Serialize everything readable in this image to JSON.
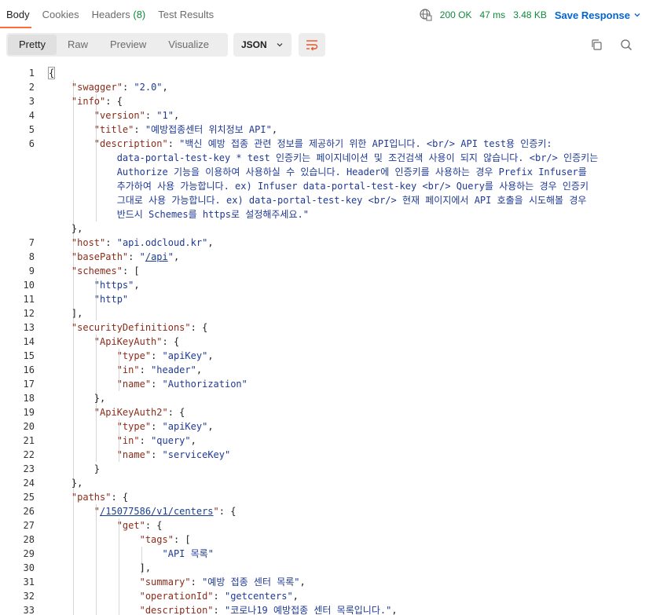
{
  "tabs": {
    "body": "Body",
    "cookies": "Cookies",
    "headers": "Headers",
    "headers_count": "(8)",
    "test_results": "Test Results"
  },
  "status": {
    "code": "200 OK",
    "time": "47 ms",
    "size": "3.48 KB",
    "save": "Save Response"
  },
  "view": {
    "pretty": "Pretty",
    "raw": "Raw",
    "preview": "Preview",
    "visualize": "Visualize",
    "format": "JSON"
  },
  "line_numbers": [
    "1",
    "2",
    "3",
    "4",
    "5",
    "6",
    "",
    "",
    "",
    "",
    "",
    "",
    "7",
    "8",
    "9",
    "10",
    "11",
    "12",
    "13",
    "14",
    "15",
    "16",
    "17",
    "18",
    "19",
    "20",
    "21",
    "22",
    "23",
    "24",
    "25",
    "26",
    "27",
    "28",
    "29",
    "30",
    "31",
    "32",
    "33",
    "34"
  ],
  "code": {
    "l1": "{",
    "l2k": "\"swagger\"",
    "l2v": "\"2.0\"",
    "l3k": "\"info\"",
    "l4k": "\"version\"",
    "l4v": "\"1\"",
    "l5k": "\"title\"",
    "l5v": "\"예방접종센터 위치정보 API\"",
    "l6k": "\"description\"",
    "l6v1": "\"백신 예방 접종 관련 정보를 제공하기 위한 API입니다. <br/> API test용 인증키:",
    "l6v2": "data-portal-test-key * test 인증키는 페이지네이션 및 조건검색 사용이 되지 않습니다. <br/> 인증키는",
    "l6v3": "Authorize 기능을 이용하여 사용하실 수 있습니다. Header에 인증키를 사용하는 경우 Prefix Infuser를",
    "l6v4": "추가하여 사용 가능합니다. ex) Infuser data-portal-test-key <br/> Query를 사용하는 경우 인증키",
    "l6v5": "그대로 사용 가능합니다. ex) data-portal-test-key <br/> 현재 페이지에서 API 호출을 시도해볼 경우",
    "l6v6": "반드시 Schemes를 https로 설정해주세요.\"",
    "l7": "},",
    "l8k": "\"host\"",
    "l8v": "\"api.odcloud.kr\"",
    "l9k": "\"basePath\"",
    "l9v": "/api",
    "l10k": "\"schemes\"",
    "l11v": "\"https\"",
    "l12v": "\"http\"",
    "l13": "],",
    "l14k": "\"securityDefinitions\"",
    "l15k": "\"ApiKeyAuth\"",
    "l16k": "\"type\"",
    "l16v": "\"apiKey\"",
    "l17k": "\"in\"",
    "l17v": "\"header\"",
    "l18k": "\"name\"",
    "l18v": "\"Authorization\"",
    "l19": "},",
    "l20k": "\"ApiKeyAuth2\"",
    "l21k": "\"type\"",
    "l21v": "\"apiKey\"",
    "l22k": "\"in\"",
    "l22v": "\"query\"",
    "l23k": "\"name\"",
    "l23v": "\"serviceKey\"",
    "l24": "}",
    "l25": "},",
    "l26k": "\"paths\"",
    "l27k": "/15077586/v1/centers",
    "l28k": "\"get\"",
    "l29k": "\"tags\"",
    "l30v": "\"API 목록\"",
    "l31": "],",
    "l32k": "\"summary\"",
    "l32v": "\"예방 접종 센터 목록\"",
    "l33k": "\"operationId\"",
    "l33v": "\"getcenters\"",
    "l34k": "\"description\"",
    "l34v": "\"코로나19 예방접종 센터 목록입니다.\""
  }
}
